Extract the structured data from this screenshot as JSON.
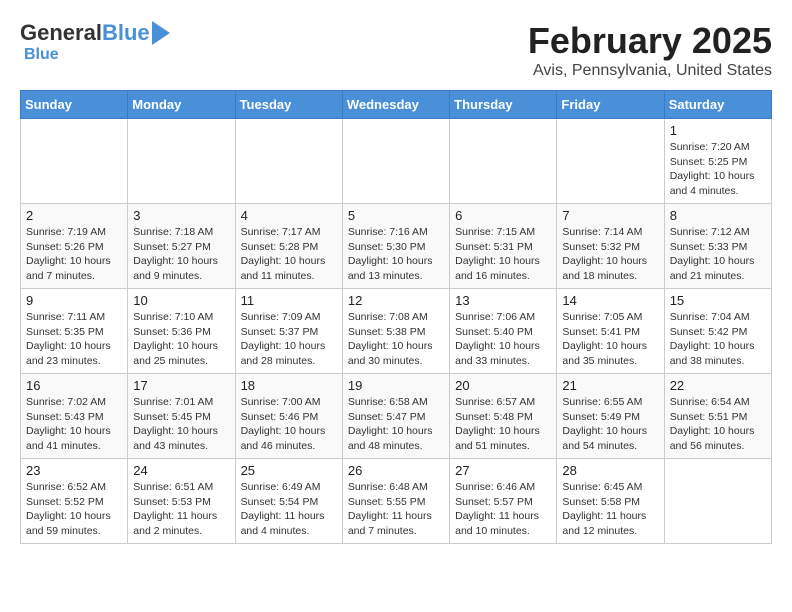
{
  "header": {
    "logo_general": "General",
    "logo_blue": "Blue",
    "title": "February 2025",
    "subtitle": "Avis, Pennsylvania, United States"
  },
  "days_of_week": [
    "Sunday",
    "Monday",
    "Tuesday",
    "Wednesday",
    "Thursday",
    "Friday",
    "Saturday"
  ],
  "weeks": [
    [
      {
        "day": "",
        "info": ""
      },
      {
        "day": "",
        "info": ""
      },
      {
        "day": "",
        "info": ""
      },
      {
        "day": "",
        "info": ""
      },
      {
        "day": "",
        "info": ""
      },
      {
        "day": "",
        "info": ""
      },
      {
        "day": "1",
        "info": "Sunrise: 7:20 AM\nSunset: 5:25 PM\nDaylight: 10 hours and 4 minutes."
      }
    ],
    [
      {
        "day": "2",
        "info": "Sunrise: 7:19 AM\nSunset: 5:26 PM\nDaylight: 10 hours and 7 minutes."
      },
      {
        "day": "3",
        "info": "Sunrise: 7:18 AM\nSunset: 5:27 PM\nDaylight: 10 hours and 9 minutes."
      },
      {
        "day": "4",
        "info": "Sunrise: 7:17 AM\nSunset: 5:28 PM\nDaylight: 10 hours and 11 minutes."
      },
      {
        "day": "5",
        "info": "Sunrise: 7:16 AM\nSunset: 5:30 PM\nDaylight: 10 hours and 13 minutes."
      },
      {
        "day": "6",
        "info": "Sunrise: 7:15 AM\nSunset: 5:31 PM\nDaylight: 10 hours and 16 minutes."
      },
      {
        "day": "7",
        "info": "Sunrise: 7:14 AM\nSunset: 5:32 PM\nDaylight: 10 hours and 18 minutes."
      },
      {
        "day": "8",
        "info": "Sunrise: 7:12 AM\nSunset: 5:33 PM\nDaylight: 10 hours and 21 minutes."
      }
    ],
    [
      {
        "day": "9",
        "info": "Sunrise: 7:11 AM\nSunset: 5:35 PM\nDaylight: 10 hours and 23 minutes."
      },
      {
        "day": "10",
        "info": "Sunrise: 7:10 AM\nSunset: 5:36 PM\nDaylight: 10 hours and 25 minutes."
      },
      {
        "day": "11",
        "info": "Sunrise: 7:09 AM\nSunset: 5:37 PM\nDaylight: 10 hours and 28 minutes."
      },
      {
        "day": "12",
        "info": "Sunrise: 7:08 AM\nSunset: 5:38 PM\nDaylight: 10 hours and 30 minutes."
      },
      {
        "day": "13",
        "info": "Sunrise: 7:06 AM\nSunset: 5:40 PM\nDaylight: 10 hours and 33 minutes."
      },
      {
        "day": "14",
        "info": "Sunrise: 7:05 AM\nSunset: 5:41 PM\nDaylight: 10 hours and 35 minutes."
      },
      {
        "day": "15",
        "info": "Sunrise: 7:04 AM\nSunset: 5:42 PM\nDaylight: 10 hours and 38 minutes."
      }
    ],
    [
      {
        "day": "16",
        "info": "Sunrise: 7:02 AM\nSunset: 5:43 PM\nDaylight: 10 hours and 41 minutes."
      },
      {
        "day": "17",
        "info": "Sunrise: 7:01 AM\nSunset: 5:45 PM\nDaylight: 10 hours and 43 minutes."
      },
      {
        "day": "18",
        "info": "Sunrise: 7:00 AM\nSunset: 5:46 PM\nDaylight: 10 hours and 46 minutes."
      },
      {
        "day": "19",
        "info": "Sunrise: 6:58 AM\nSunset: 5:47 PM\nDaylight: 10 hours and 48 minutes."
      },
      {
        "day": "20",
        "info": "Sunrise: 6:57 AM\nSunset: 5:48 PM\nDaylight: 10 hours and 51 minutes."
      },
      {
        "day": "21",
        "info": "Sunrise: 6:55 AM\nSunset: 5:49 PM\nDaylight: 10 hours and 54 minutes."
      },
      {
        "day": "22",
        "info": "Sunrise: 6:54 AM\nSunset: 5:51 PM\nDaylight: 10 hours and 56 minutes."
      }
    ],
    [
      {
        "day": "23",
        "info": "Sunrise: 6:52 AM\nSunset: 5:52 PM\nDaylight: 10 hours and 59 minutes."
      },
      {
        "day": "24",
        "info": "Sunrise: 6:51 AM\nSunset: 5:53 PM\nDaylight: 11 hours and 2 minutes."
      },
      {
        "day": "25",
        "info": "Sunrise: 6:49 AM\nSunset: 5:54 PM\nDaylight: 11 hours and 4 minutes."
      },
      {
        "day": "26",
        "info": "Sunrise: 6:48 AM\nSunset: 5:55 PM\nDaylight: 11 hours and 7 minutes."
      },
      {
        "day": "27",
        "info": "Sunrise: 6:46 AM\nSunset: 5:57 PM\nDaylight: 11 hours and 10 minutes."
      },
      {
        "day": "28",
        "info": "Sunrise: 6:45 AM\nSunset: 5:58 PM\nDaylight: 11 hours and 12 minutes."
      },
      {
        "day": "",
        "info": ""
      }
    ]
  ]
}
